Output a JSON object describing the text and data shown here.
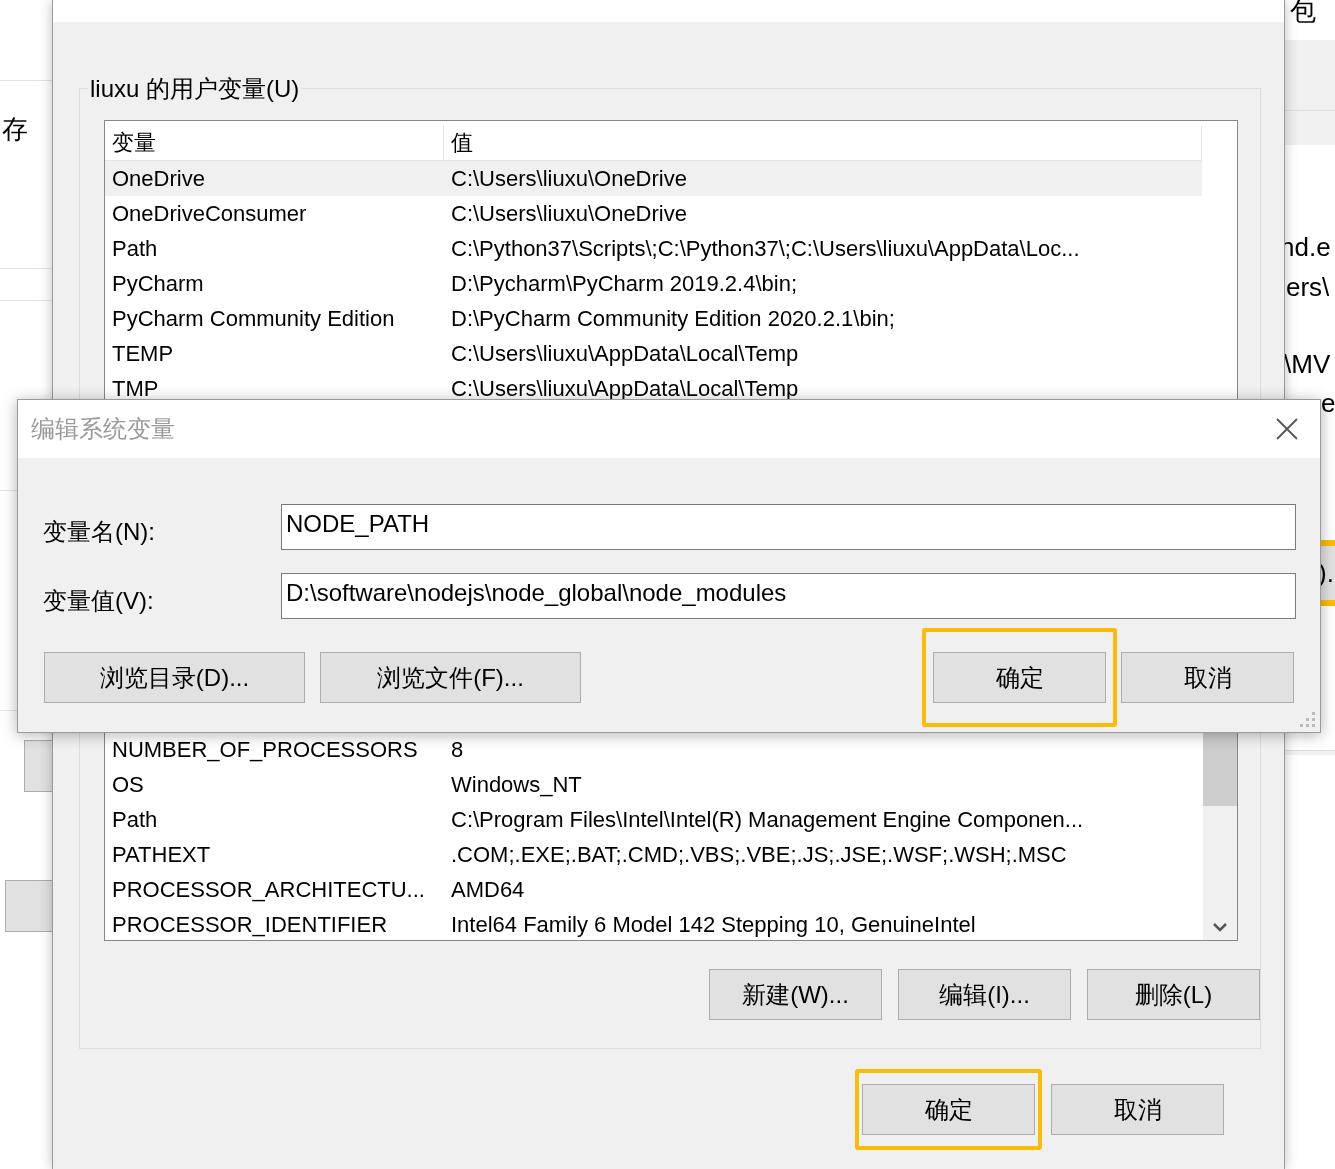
{
  "background_left": {
    "texts": [
      "存"
    ]
  },
  "background_right": {
    "texts": [
      "包",
      "nd.e",
      "ers\\",
      "\\MV",
      "e"
    ],
    "button": {
      "label": ").",
      "highlighted": true
    }
  },
  "main_window": {
    "user_group": {
      "title": "liuxu 的用户变量(U)",
      "columns": [
        "变量",
        "值"
      ],
      "rows": [
        {
          "name": "OneDrive",
          "value": "C:\\Users\\liuxu\\OneDrive",
          "selected": true
        },
        {
          "name": "OneDriveConsumer",
          "value": "C:\\Users\\liuxu\\OneDrive",
          "selected": false
        },
        {
          "name": "Path",
          "value": "C:\\Python37\\Scripts\\;C:\\Python37\\;C:\\Users\\liuxu\\AppData\\Loc...",
          "selected": false
        },
        {
          "name": "PyCharm",
          "value": "D:\\Pycharm\\PyCharm 2019.2.4\\bin;",
          "selected": false
        },
        {
          "name": "PyCharm Community Edition",
          "value": "D:\\PyCharm Community Edition 2020.2.1\\bin;",
          "selected": false
        },
        {
          "name": "TEMP",
          "value": "C:\\Users\\liuxu\\AppData\\Local\\Temp",
          "selected": false
        },
        {
          "name": "TMP",
          "value": "C:\\Users\\liuxu\\AppData\\Local\\Temp",
          "selected": false
        }
      ]
    },
    "system_group": {
      "rows": [
        {
          "name": "NUMBER_OF_PROCESSORS",
          "value": "8",
          "selected": false
        },
        {
          "name": "OS",
          "value": "Windows_NT",
          "selected": false
        },
        {
          "name": "Path",
          "value": "C:\\Program Files\\Intel\\Intel(R) Management Engine Componen...",
          "selected": false
        },
        {
          "name": "PATHEXT",
          "value": ".COM;.EXE;.BAT;.CMD;.VBS;.VBE;.JS;.JSE;.WSF;.WSH;.MSC",
          "selected": false
        },
        {
          "name": "PROCESSOR_ARCHITECTU...",
          "value": "AMD64",
          "selected": false
        },
        {
          "name": "PROCESSOR_IDENTIFIER",
          "value": "Intel64 Family 6 Model 142 Stepping 10, GenuineIntel",
          "selected": false
        }
      ],
      "buttons": [
        {
          "label": "新建(W)..."
        },
        {
          "label": "编辑(I)..."
        },
        {
          "label": "删除(L)"
        }
      ]
    },
    "buttons": [
      {
        "label": "确定",
        "highlighted": true
      },
      {
        "label": "取消",
        "highlighted": false
      }
    ]
  },
  "edit_dialog": {
    "title": "编辑系统变量",
    "fields": [
      {
        "label": "变量名(N):",
        "value": "NODE_PATH"
      },
      {
        "label": "变量值(V):",
        "value": "D:\\software\\nodejs\\node_global\\node_modules"
      }
    ],
    "buttons": [
      {
        "label": "浏览目录(D)...",
        "kind": "wide",
        "highlighted": false
      },
      {
        "label": "浏览文件(F)...",
        "kind": "wide",
        "highlighted": false
      },
      {
        "label": "确定",
        "kind": "narrow",
        "highlighted": true
      },
      {
        "label": "取消",
        "kind": "narrow",
        "highlighted": false
      }
    ]
  }
}
